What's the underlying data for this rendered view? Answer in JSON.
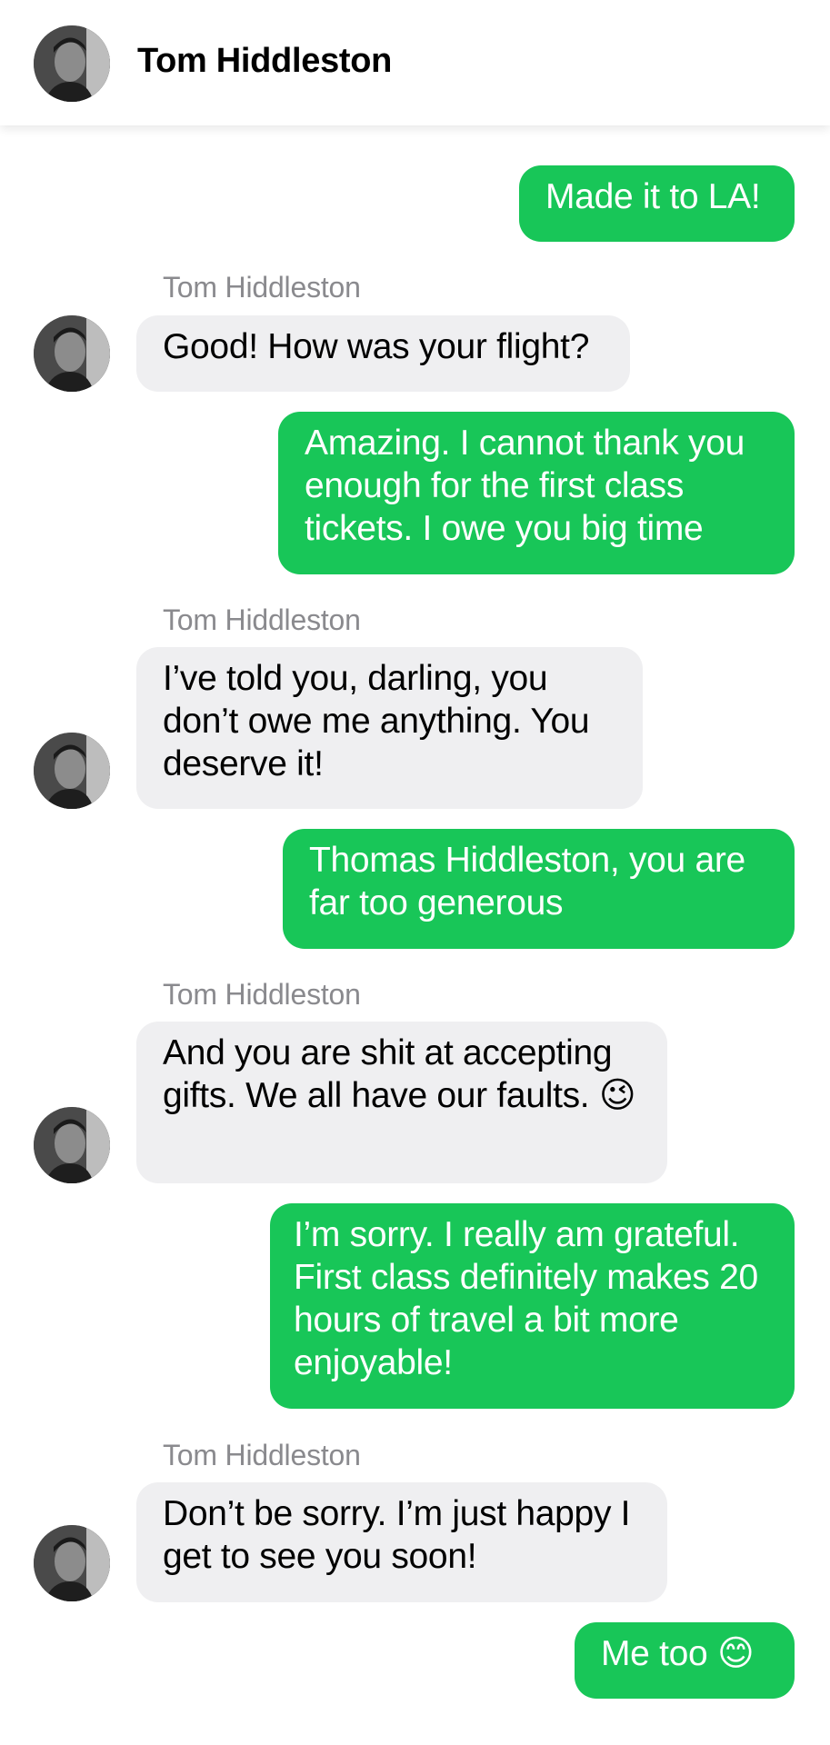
{
  "header": {
    "name": "Tom Hiddleston"
  },
  "messages": [
    {
      "from": "me",
      "text": "Made it to LA!"
    },
    {
      "from": "them",
      "sender": "Tom Hiddleston",
      "text": "Good! How was your flight?"
    },
    {
      "from": "me",
      "text": "Amazing. I cannot thank you enough for the first class tickets. I owe you big time"
    },
    {
      "from": "them",
      "sender": "Tom Hiddleston",
      "text": "I’ve told you, darling, you don’t owe me anything. You deserve it!"
    },
    {
      "from": "me",
      "text": "Thomas Hiddleston, you are far too generous"
    },
    {
      "from": "them",
      "sender": "Tom Hiddleston",
      "text": "And you are shit at accepting gifts. We all have our faults. 😉"
    },
    {
      "from": "me",
      "text": "I’m sorry. I really am grateful. First class definitely makes 20 hours of travel a bit more enjoyable!"
    },
    {
      "from": "them",
      "sender": "Tom Hiddleston",
      "text": "Don’t be sorry. I’m just happy I get to see you soon!"
    },
    {
      "from": "me",
      "text": "Me too 😊"
    }
  ],
  "colors": {
    "sent_bubble": "#18c658",
    "received_bubble": "#efeff1",
    "sender_label": "#8a8a8e"
  }
}
